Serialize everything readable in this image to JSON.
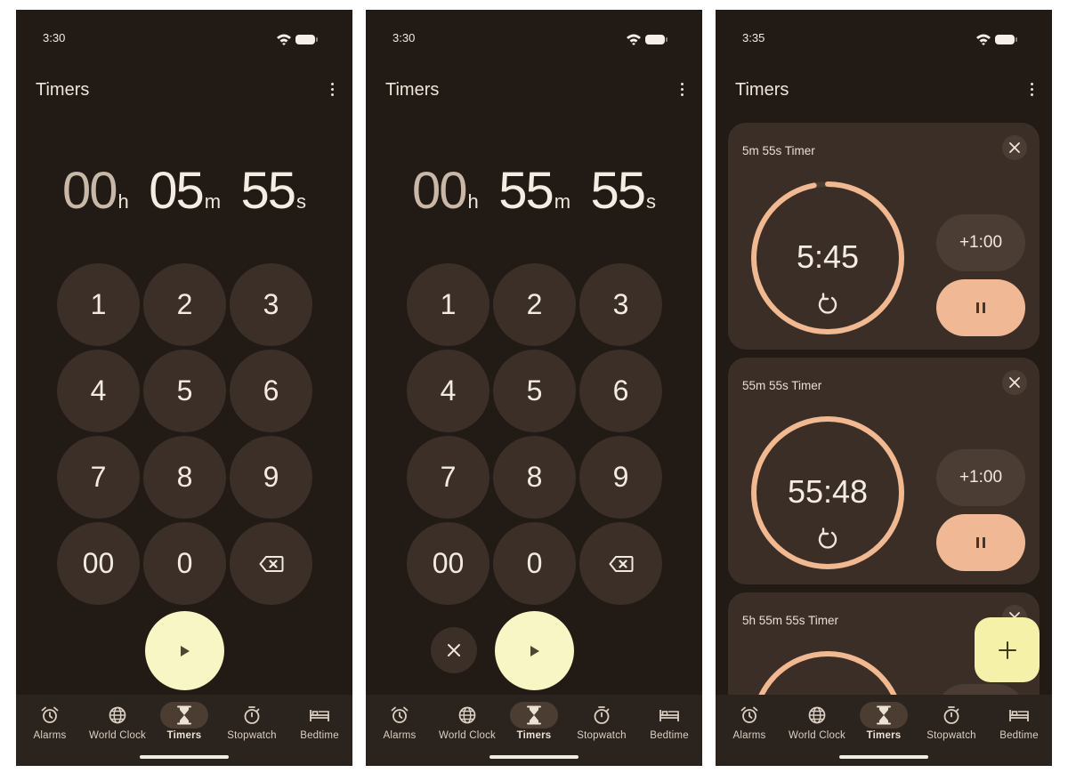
{
  "screens": [
    {
      "status_time": "3:30",
      "title": "Timers",
      "display": {
        "hours": "00",
        "minutes": "05",
        "seconds": "55",
        "h_unit": "h",
        "m_unit": "m",
        "s_unit": "s"
      },
      "keypad": [
        "1",
        "2",
        "3",
        "4",
        "5",
        "6",
        "7",
        "8",
        "9",
        "00",
        "0"
      ],
      "backspace_icon": "backspace-icon",
      "start_icon": "play-icon"
    },
    {
      "status_time": "3:30",
      "title": "Timers",
      "display": {
        "hours": "00",
        "minutes": "55",
        "seconds": "55",
        "h_unit": "h",
        "m_unit": "m",
        "s_unit": "s"
      },
      "keypad": [
        "1",
        "2",
        "3",
        "4",
        "5",
        "6",
        "7",
        "8",
        "9",
        "00",
        "0"
      ],
      "backspace_icon": "backspace-icon",
      "start_icon": "play-icon",
      "cancel_icon": "close-icon"
    },
    {
      "status_time": "3:35",
      "title": "Timers",
      "timers": [
        {
          "name": "5m 55s Timer",
          "remaining": "5:45",
          "add_label": "+1:00",
          "progress": 0.97
        },
        {
          "name": "55m 55s Timer",
          "remaining": "55:48",
          "add_label": "+1:00",
          "progress": 1.0
        },
        {
          "name": "5h 55m 55s Timer"
        }
      ],
      "fab_icon": "plus-icon"
    }
  ],
  "nav": {
    "items": [
      {
        "label": "Alarms",
        "icon": "alarm-icon"
      },
      {
        "label": "World Clock",
        "icon": "globe-icon"
      },
      {
        "label": "Timers",
        "icon": "hourglass-icon",
        "active": true
      },
      {
        "label": "Stopwatch",
        "icon": "stopwatch-icon"
      },
      {
        "label": "Bedtime",
        "icon": "bed-icon"
      }
    ]
  },
  "colors": {
    "background": "#211a15",
    "key": "#3b2f27",
    "start_button": "#f8f6c4",
    "ring": "#f2b990",
    "pause_button": "#f0b894",
    "fab": "#f6f1a8"
  }
}
